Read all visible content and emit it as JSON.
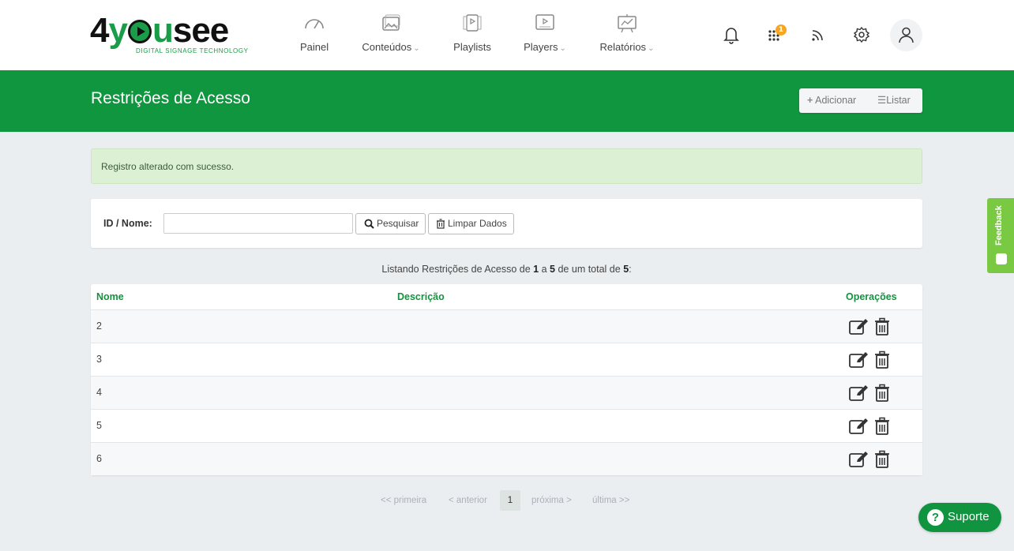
{
  "brand": {
    "name_part1": "4",
    "name_y": "y",
    "name_part2": "u",
    "name_part3": "see",
    "tagline": "DIGITAL SIGNAGE TECHNOLOGY"
  },
  "nav": {
    "items": [
      {
        "label": "Painel",
        "icon": "gauge-icon",
        "dropdown": false
      },
      {
        "label": "Conteúdos",
        "icon": "images-icon",
        "dropdown": true
      },
      {
        "label": "Playlists",
        "icon": "playlist-icon",
        "dropdown": false
      },
      {
        "label": "Players",
        "icon": "player-icon",
        "dropdown": true
      },
      {
        "label": "Relatórios",
        "icon": "report-icon",
        "dropdown": true
      }
    ],
    "chevron": "⌄",
    "apps_badge": "1"
  },
  "header": {
    "title": "Restrições de Acesso",
    "add_label": "Adicionar",
    "list_label": "Listar"
  },
  "alert": {
    "message": "Registro alterado com sucesso."
  },
  "search": {
    "label": "ID / Nome:",
    "value": "",
    "search_button": "Pesquisar",
    "clear_button": "Limpar Dados"
  },
  "listing": {
    "prefix": "Listando Restrições de Acesso de",
    "from": "1",
    "a": "a",
    "to": "5",
    "mid": "de um total de",
    "total": "5",
    "suffix": ":"
  },
  "table": {
    "columns": {
      "name": "Nome",
      "description": "Descrição",
      "operations": "Operações"
    },
    "rows": [
      {
        "name": "2",
        "description": ""
      },
      {
        "name": "3",
        "description": ""
      },
      {
        "name": "4",
        "description": ""
      },
      {
        "name": "5",
        "description": ""
      },
      {
        "name": "6",
        "description": ""
      }
    ]
  },
  "pagination": {
    "first": "<< primeira",
    "prev": "< anterior",
    "current": "1",
    "next": "próxima >",
    "last": "última >>"
  },
  "feedback": {
    "label": "Feedback"
  },
  "support": {
    "label": "Suporte",
    "icon_glyph": "?"
  },
  "colors": {
    "primary_green": "#10963f",
    "accent_orange": "#f5a623",
    "feedback_green": "#7ac943"
  }
}
